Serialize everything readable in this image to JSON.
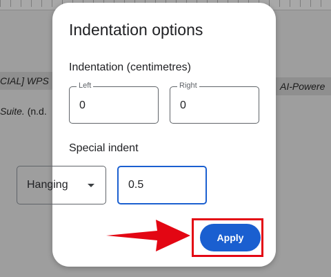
{
  "background": {
    "left_line1": "CIAL] WPS",
    "left_line2_italic": "Suite.",
    "left_line2_rest": " (n.d.",
    "right_line1": "AI-Powere"
  },
  "dialog": {
    "title": "Indentation options",
    "indentation_heading": "Indentation (centimetres)",
    "left": {
      "label": "Left",
      "value": "0"
    },
    "right": {
      "label": "Right",
      "value": "0"
    },
    "special_heading": "Special indent",
    "special_type": "Hanging",
    "special_value": "0.5",
    "apply_label": "Apply"
  },
  "colors": {
    "accent": "#1a5fd0",
    "annotation": "#e30613"
  },
  "icons": [
    "dropdown-caret-icon",
    "red-arrow-annotation"
  ]
}
